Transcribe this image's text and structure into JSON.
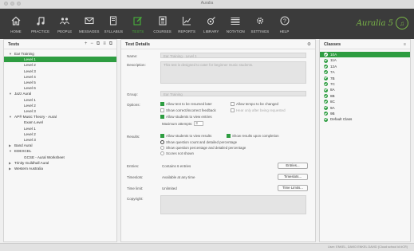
{
  "window": {
    "title": "Auralia"
  },
  "toolbar": {
    "items": [
      {
        "label": "HOME",
        "icon": "home-icon"
      },
      {
        "label": "PRACTICE",
        "icon": "music-note-icon"
      },
      {
        "label": "PEOPLE",
        "icon": "people-icon"
      },
      {
        "label": "MESSAGES",
        "icon": "envelope-icon"
      },
      {
        "label": "SYLLABUS",
        "icon": "book-icon"
      },
      {
        "label": "TESTS",
        "icon": "edit-icon"
      },
      {
        "label": "COURSES",
        "icon": "courses-icon"
      },
      {
        "label": "REPORTS",
        "icon": "chart-icon"
      },
      {
        "label": "LIBRARY",
        "icon": "library-icon"
      },
      {
        "label": "NOTATION",
        "icon": "staff-icon"
      },
      {
        "label": "SETTINGS",
        "icon": "gear-icon"
      },
      {
        "label": "HELP",
        "icon": "help-icon"
      }
    ],
    "active": "TESTS",
    "brand": "Auralia 5",
    "active_color": "#48b23b"
  },
  "tests_panel": {
    "title": "Tests",
    "tools": [
      "+",
      "−",
      "⧉",
      "≡",
      "⧉"
    ],
    "tree": [
      {
        "label": "Ear Training",
        "level": 0,
        "expander": "▼"
      },
      {
        "label": "Level 1",
        "level": 1,
        "selected": true
      },
      {
        "label": "Level 2",
        "level": 1
      },
      {
        "label": "Level 3",
        "level": 1
      },
      {
        "label": "Level 4",
        "level": 1
      },
      {
        "label": "Level 5",
        "level": 1
      },
      {
        "label": "Level 6",
        "level": 1
      },
      {
        "label": "Jazz Aural",
        "level": 0,
        "expander": "▼"
      },
      {
        "label": "Level 1",
        "level": 1
      },
      {
        "label": "Level 2",
        "level": 1
      },
      {
        "label": "Level 3",
        "level": 1
      },
      {
        "label": "AP® Music Theory - Aural",
        "level": 0,
        "expander": "▼"
      },
      {
        "label": "Exam Level",
        "level": 1
      },
      {
        "label": "Level 1",
        "level": 1
      },
      {
        "label": "Level 2",
        "level": 1
      },
      {
        "label": "Level 3",
        "level": 1
      },
      {
        "label": "Band Aural",
        "level": 0,
        "expander": "▶"
      },
      {
        "label": "EDEXCEL",
        "level": 0,
        "expander": "▼"
      },
      {
        "label": "GCSE - Aural Worksheet",
        "level": 1
      },
      {
        "label": "Trinity Guildhall Aural",
        "level": 0,
        "expander": "▶"
      },
      {
        "label": "Western Australia",
        "level": 0,
        "expander": "▶"
      }
    ]
  },
  "details_panel": {
    "title": "Test Details",
    "name_label": "Name:",
    "name_value": "Ear Training - Level 1",
    "description_label": "Description:",
    "description_value": "This test is designed to cater for beginner music students.",
    "group_label": "Group:",
    "group_value": "Ear Training",
    "options_label": "Options:",
    "options": {
      "resume": "Allow test to be resumed later",
      "tempo": "Allow tempo to be changed",
      "feedback": "Show correct/incorrect feedback",
      "hear_again": "Hear only after being requested",
      "view_entries": "Allow students to view entries",
      "max_attempts_label": "Maximum attempts:",
      "max_attempts_value": "3"
    },
    "results_label": "Results:",
    "results": {
      "view_results": "Allow students to view results",
      "show_upon_completion": "Show results upon completion",
      "radio_count": "Show question count and detailed percentage",
      "radio_percentage": "Show question percentage and detailed percentage",
      "radio_hidden": "Scores not shown"
    },
    "entries_label": "Entries:",
    "entries_value": "Contains 6 entries",
    "entries_button": "Entries...",
    "timeslots_label": "Timeslots:",
    "timeslots_value": "Available at any time",
    "timeslots_button": "Timeslots...",
    "timelimit_label": "Time limit:",
    "timelimit_value": "Unlimited",
    "timelimit_button": "Time Limits...",
    "copyright_label": "Copyright:"
  },
  "classes_panel": {
    "title": "Classes",
    "items": [
      {
        "label": "10A",
        "selected": true
      },
      {
        "label": "11A"
      },
      {
        "label": "12A"
      },
      {
        "label": "7A"
      },
      {
        "label": "7B"
      },
      {
        "label": "7C"
      },
      {
        "label": "8A"
      },
      {
        "label": "8B"
      },
      {
        "label": "8C"
      },
      {
        "label": "9A"
      },
      {
        "label": "9B"
      },
      {
        "label": "Default Class"
      }
    ]
  },
  "status": {
    "text": "User: ENKEL, DAVID ENKEL DAVID (Cloud school id #CR)"
  }
}
